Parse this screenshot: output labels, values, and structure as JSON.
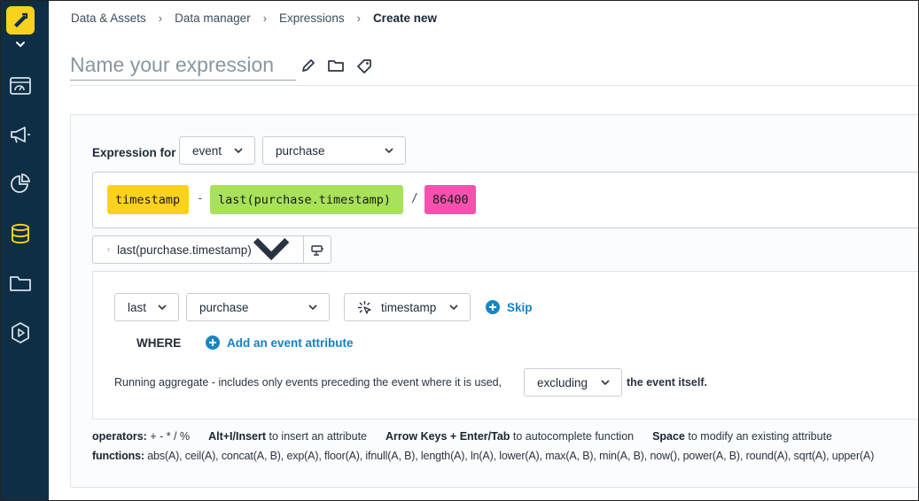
{
  "breadcrumb": {
    "items": [
      "Data & Assets",
      "Data manager",
      "Expressions"
    ],
    "current": "Create new"
  },
  "expression_name": {
    "placeholder": "Name your expression",
    "value": ""
  },
  "expression_for": {
    "label": "Expression for",
    "entity_type": "event",
    "entity_name": "purchase"
  },
  "expression_tokens": {
    "t1": "timestamp",
    "op1": "-",
    "t2": "last(purchase.timestamp)",
    "op2": "/",
    "t3": "86400"
  },
  "function_editor": {
    "selected_function": "last(purchase.timestamp)",
    "aggregation": "last",
    "event": "purchase",
    "attribute": "timestamp",
    "skip_label": "Skip",
    "where_label": "WHERE",
    "add_attribute_label": "Add an event attribute",
    "running_text_before": "Running aggregate - includes only events preceding the event where it is used,",
    "running_option": "excluding",
    "running_text_after": "the event itself."
  },
  "help": {
    "operators_label": "operators:",
    "operators_value": "+ - * / %",
    "shortcut1_key": "Alt+I/Insert",
    "shortcut1_text": "to insert an attribute",
    "shortcut2_key": "Arrow Keys + Enter/Tab",
    "shortcut2_text": "to autocomplete function",
    "shortcut3_key": "Space",
    "shortcut3_text": "to modify an existing attribute",
    "functions_label": "functions:",
    "functions_value": "abs(A), ceil(A), concat(A, B), exp(A), floor(A), ifnull(A, B), length(A), ln(A), lower(A), max(A, B), min(A, B), now(), power(A, B), round(A), sqrt(A), upper(A)"
  },
  "colors": {
    "sidebar": "#0d2e44",
    "logo": "#f7d21e",
    "active_nav": "#f7d21e",
    "token_attribute": "#fcd21c",
    "token_function": "#a7e25a",
    "token_number": "#f552b0",
    "link": "#1580c2"
  },
  "icons": {
    "logo": "brand-logo-icon",
    "nav": [
      "dashboard-icon",
      "megaphone-icon",
      "pie-chart-icon",
      "database-icon",
      "folder-icon",
      "play-circle-icon"
    ],
    "title": [
      "pencil-icon",
      "folder-icon",
      "tag-icon"
    ]
  }
}
